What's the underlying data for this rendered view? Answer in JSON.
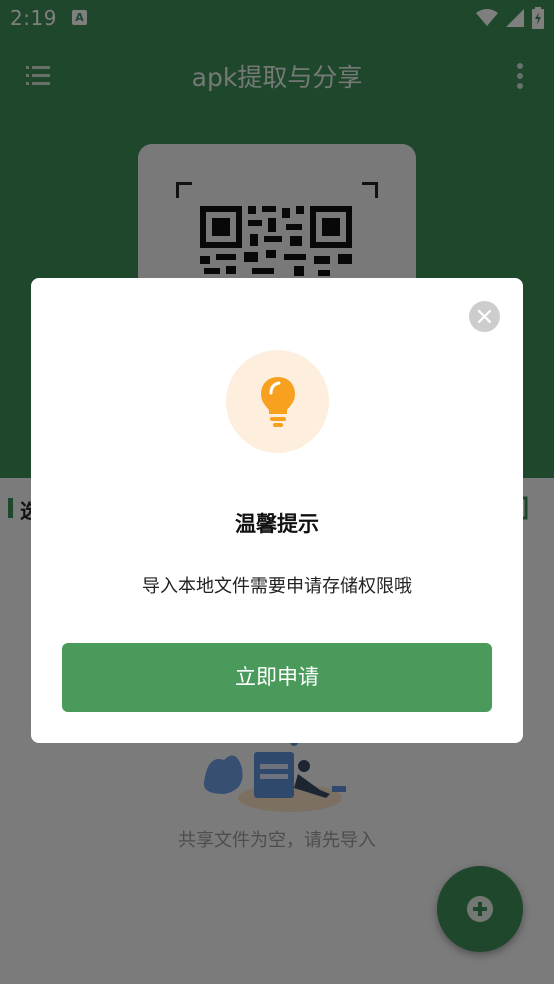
{
  "status_bar": {
    "time": "2:19",
    "notification_icon": "a-letter-icon",
    "icons": [
      "wifi-icon",
      "signal-icon",
      "battery-icon"
    ]
  },
  "app_bar": {
    "title": "apk提取与分享",
    "menu_icon": "menu-list-icon",
    "more_icon": "more-vertical-icon"
  },
  "section": {
    "title_visible": "选"
  },
  "empty_state": {
    "text": "共享文件为空，请先导入"
  },
  "dialog": {
    "title": "温馨提示",
    "message": "导入本地文件需要申请存储权限哦",
    "confirm_label": "立即申请",
    "icon": "lightbulb-icon"
  },
  "colors": {
    "primary": "#3f8e56",
    "button": "#4a9a5c",
    "bulb": "#f7a11f",
    "bulb_bg": "#fdeedd",
    "scrim": "rgba(0,0,0,0.5)"
  }
}
